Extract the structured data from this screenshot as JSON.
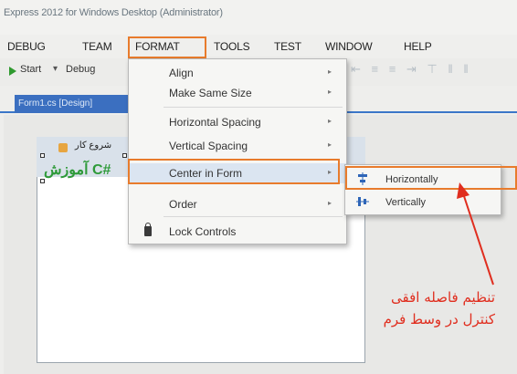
{
  "window": {
    "title": "Express 2012 for Windows Desktop (Administrator)"
  },
  "menubar": {
    "items": [
      "DEBUG",
      "TEAM",
      "FORMAT",
      "TOOLS",
      "TEST",
      "WINDOW",
      "HELP"
    ],
    "highlighted": "FORMAT"
  },
  "toolbar": {
    "start_label": "Start",
    "dropdown": "▾",
    "debug_label": "Debug"
  },
  "tab": {
    "label": "Form1.cs [Design]"
  },
  "designer_form": {
    "title": "شروع کار",
    "label": "آموزش C#"
  },
  "format_menu": {
    "items": [
      {
        "label": "Align",
        "submenu": true
      },
      {
        "label": "Make Same Size",
        "submenu": true
      },
      {
        "label": "Horizontal Spacing",
        "submenu": true
      },
      {
        "label": "Vertical Spacing",
        "submenu": true
      },
      {
        "label": "Center in Form",
        "submenu": true,
        "selected": true
      },
      {
        "label": "Order",
        "submenu": true
      },
      {
        "label": "Lock Controls",
        "submenu": false,
        "icon": "lock-icon"
      }
    ],
    "arrow_glyph": "▸"
  },
  "center_submenu": {
    "items": [
      {
        "label": "Horizontally",
        "icon": "center-horizontally-icon",
        "glyph": "⯀"
      },
      {
        "label": "Vertically",
        "icon": "center-vertically-icon",
        "glyph": "⯀"
      }
    ]
  },
  "callout": {
    "line1": "تنظیم فاصله افقی",
    "line2": "کنترل در وسط فرم",
    "color": "#e02e1f"
  },
  "colors": {
    "highlight_box": "#e87b2c",
    "tab_active": "#3b6fc0",
    "form_label": "#2e9a39"
  }
}
